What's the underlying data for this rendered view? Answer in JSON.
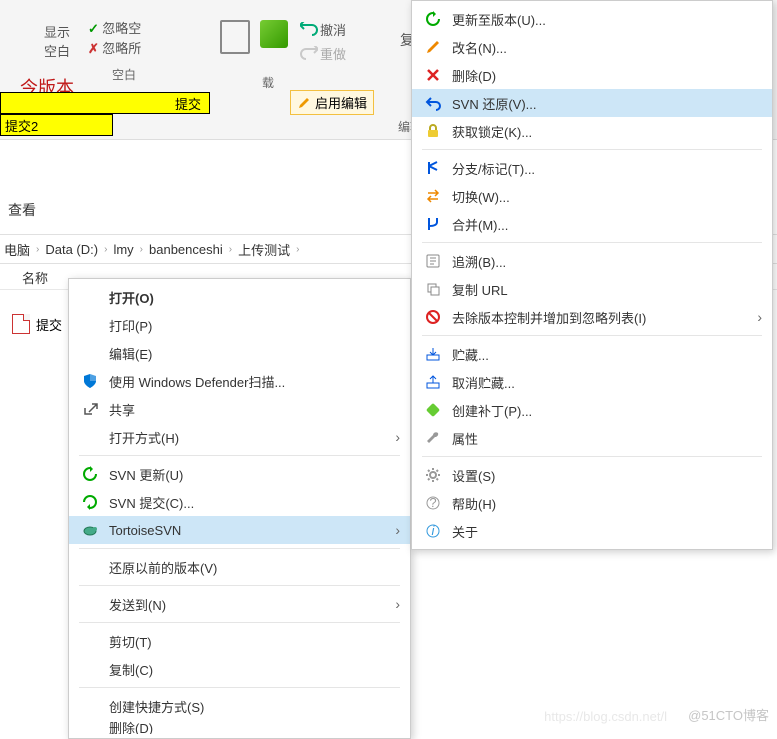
{
  "ribbon": {
    "show_blank_btn": "显示\n空白",
    "ignore_blank_check": "忽略空",
    "ignore_all_check": "忽略所",
    "blank_label": "空白",
    "undo": "撤消",
    "redo": "重做",
    "download": "载",
    "enable_edit": "启用编辑",
    "copy_group": "复",
    "edit_group": "编辑"
  },
  "doc": {
    "version_label": "今版本",
    "commit": "提交",
    "commit2": "提交2"
  },
  "view_label": "查看",
  "breadcrumb": {
    "root": "电脑",
    "drive": "Data (D:)",
    "dir1": "lmy",
    "dir2": "banbenceshi",
    "dir3": "上传测试"
  },
  "col_name": "名称",
  "file_name": "提交",
  "ctx1": {
    "open": "打开(O)",
    "print": "打印(P)",
    "edit": "编辑(E)",
    "defender": "使用 Windows Defender扫描...",
    "share": "共享",
    "open_with": "打开方式(H)",
    "svn_update": "SVN 更新(U)",
    "svn_commit": "SVN 提交(C)...",
    "tortoise": "TortoiseSVN",
    "restore_prev": "还原以前的版本(V)",
    "send_to": "发送到(N)",
    "cut": "剪切(T)",
    "copy": "复制(C)",
    "shortcut": "创建快捷方式(S)",
    "delete": "删除(D)"
  },
  "ctx2": {
    "update_to_rev": "更新至版本(U)...",
    "rename": "改名(N)...",
    "delete": "删除(D)",
    "svn_revert": "SVN 还原(V)...",
    "get_lock": "获取锁定(K)...",
    "branch_tag": "分支/标记(T)...",
    "switch": "切换(W)...",
    "merge": "合并(M)...",
    "blame": "追溯(B)...",
    "copy_url": "复制 URL",
    "remove_ignore": "去除版本控制并增加到忽略列表(I)",
    "shelve": "贮藏...",
    "unshelve": "取消贮藏...",
    "create_patch": "创建补丁(P)...",
    "properties": "属性",
    "settings": "设置(S)",
    "help": "帮助(H)",
    "about": "关于"
  },
  "watermark": "@51CTO博客",
  "watermark2": "https://blog.csdn.net/l"
}
